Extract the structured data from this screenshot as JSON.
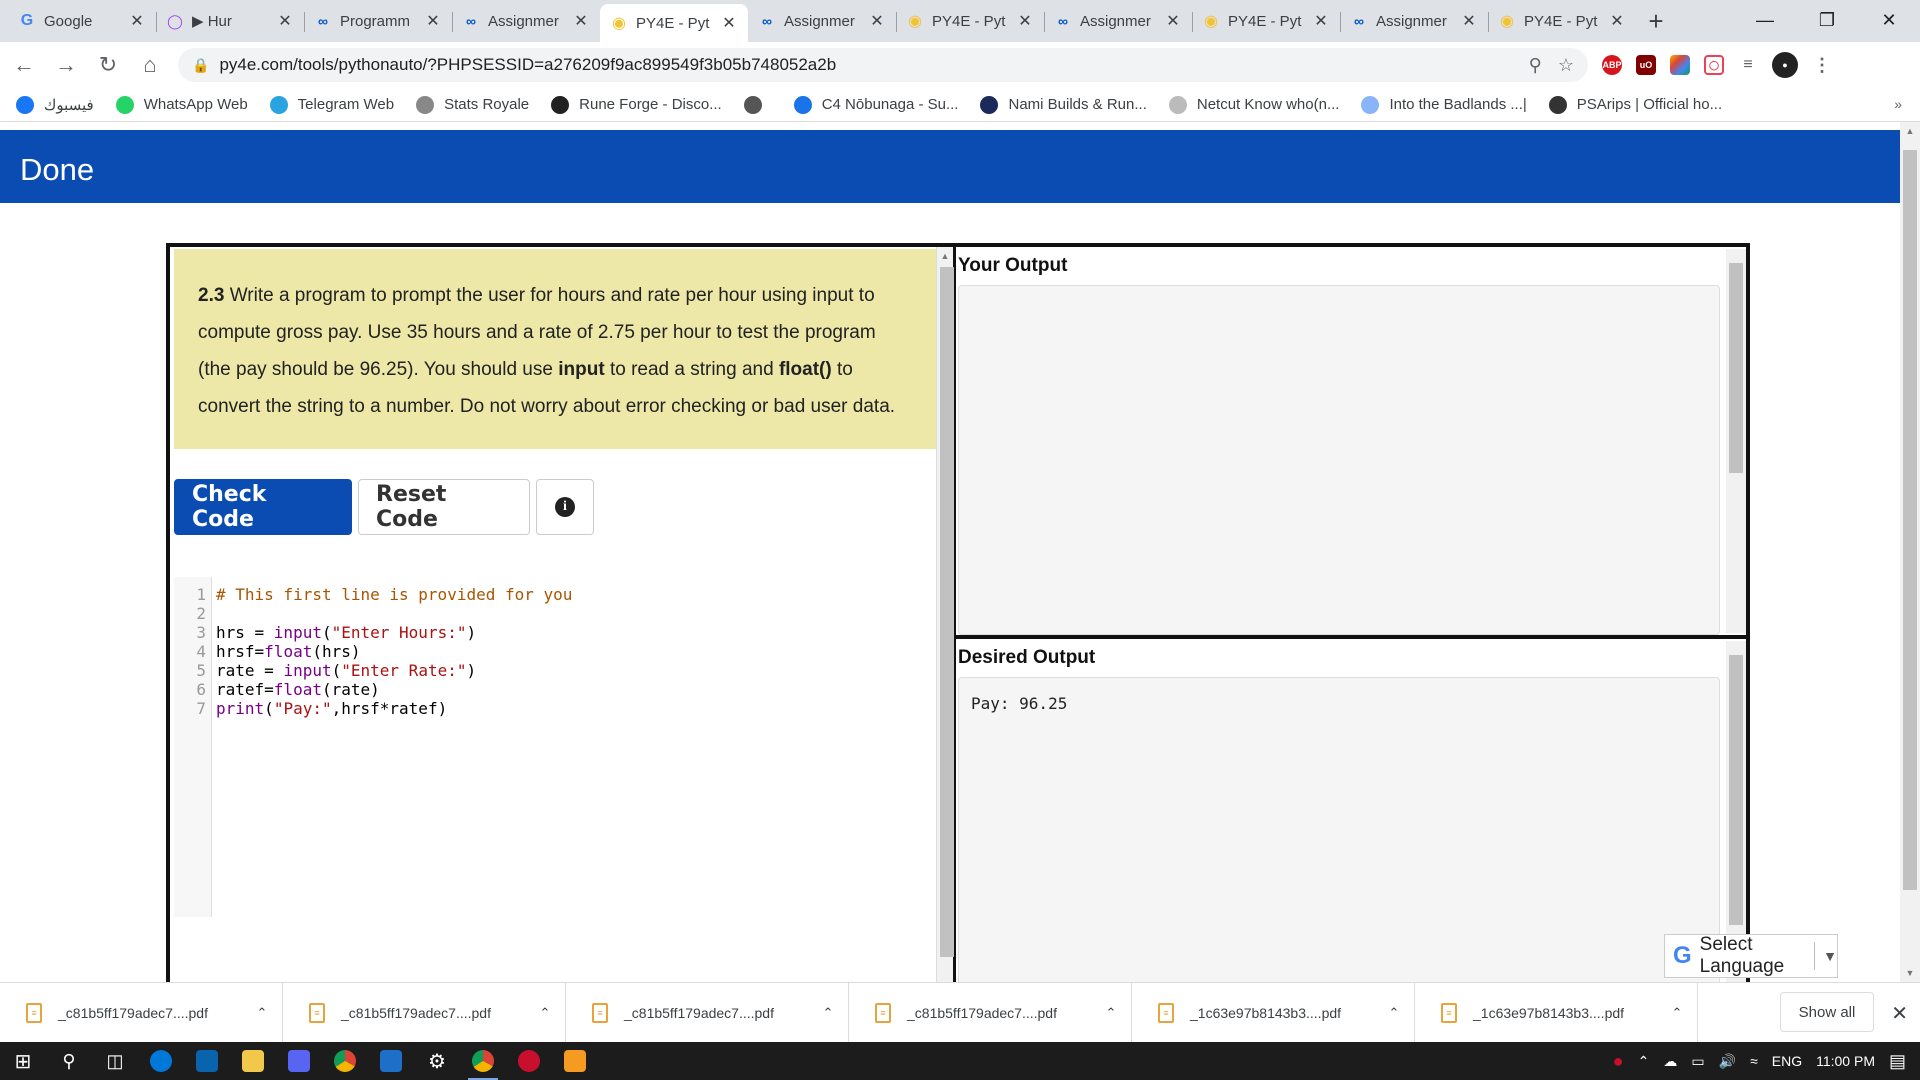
{
  "browser": {
    "tabs": [
      {
        "title": "Google",
        "icon": "google-icon",
        "active": false
      },
      {
        "title": "▶ Hur",
        "icon": "media-icon",
        "active": false
      },
      {
        "title": "Programm",
        "icon": "coursera-icon",
        "active": false
      },
      {
        "title": "Assignmer",
        "icon": "coursera-icon",
        "active": false
      },
      {
        "title": "PY4E - Pyt",
        "icon": "python-icon",
        "active": true
      },
      {
        "title": "Assignmer",
        "icon": "coursera-icon",
        "active": false
      },
      {
        "title": "PY4E - Pyt",
        "icon": "python-icon",
        "active": false
      },
      {
        "title": "Assignmer",
        "icon": "coursera-icon",
        "active": false
      },
      {
        "title": "PY4E - Pyt",
        "icon": "python-icon",
        "active": false
      },
      {
        "title": "Assignmer",
        "icon": "coursera-icon",
        "active": false
      },
      {
        "title": "PY4E - Pyt",
        "icon": "python-icon",
        "active": false
      }
    ],
    "url": "py4e.com/tools/pythonauto/?PHPSESSID=a276209f9ac899549f3b05b748052a2b",
    "bookmarks": [
      {
        "label": "فيسبوك",
        "icon": "facebook-icon",
        "color": "#1877f2"
      },
      {
        "label": "WhatsApp Web",
        "icon": "whatsapp-icon",
        "color": "#25d366"
      },
      {
        "label": "Telegram Web",
        "icon": "telegram-icon",
        "color": "#2aa3e0"
      },
      {
        "label": "Stats Royale",
        "icon": "stats-royale-icon",
        "color": "#888888"
      },
      {
        "label": "Rune Forge - Disco...",
        "icon": "rune-forge-icon",
        "color": "#222222"
      },
      {
        "label": "",
        "icon": "globe-icon",
        "color": "#555555"
      },
      {
        "label": "C4 Nōbunaga - Su...",
        "icon": "c4-icon",
        "color": "#1a73e8"
      },
      {
        "label": "Nami Builds & Run...",
        "icon": "nami-icon",
        "color": "#1a2a5a"
      },
      {
        "label": "Netcut Know who(n...",
        "icon": "netcut-icon",
        "color": "#bbbbbb"
      },
      {
        "label": "Into the Badlands ...|",
        "icon": "badlands-icon",
        "color": "#8ab4f8"
      },
      {
        "label": "PSArips | Official ho...",
        "icon": "psarips-icon",
        "color": "#333333"
      }
    ],
    "bookmarks_more": "»"
  },
  "page": {
    "banner_title": "Done",
    "prompt": {
      "number": "2.3",
      "text_1": " Write a program to prompt the user for hours and rate per hour using input to compute gross pay. Use 35 hours and a rate of 2.75 per hour to test the program (the pay should be 96.25). You should use ",
      "bold_1": "input",
      "text_2": " to read a string and ",
      "bold_2": "float()",
      "text_3": " to convert the string to a number. Do not worry about error checking or bad user data."
    },
    "buttons": {
      "check": "Check Code",
      "reset": "Reset Code"
    },
    "code_lines": [
      {
        "n": "1",
        "text": "# This first line is provided for you"
      },
      {
        "n": "2",
        "text": ""
      },
      {
        "n": "3",
        "text": "hrs = input(\"Enter Hours:\")"
      },
      {
        "n": "4",
        "text": "hrsf=float(hrs)"
      },
      {
        "n": "5",
        "text": "rate = input(\"Enter Rate:\")"
      },
      {
        "n": "6",
        "text": "ratef=float(rate)"
      },
      {
        "n": "7",
        "text": "print(\"Pay:\",hrsf*ratef)"
      }
    ],
    "your_output_title": "Your Output",
    "your_output_text": "",
    "desired_output_title": "Desired Output",
    "desired_output_text": "Pay: 96.25",
    "translate_label": "Select Language"
  },
  "downloads": {
    "items": [
      "_c81b5ff179adec7....pdf",
      "_c81b5ff179adec7....pdf",
      "_c81b5ff179adec7....pdf",
      "_c81b5ff179adec7....pdf",
      "_1c63e97b8143b3....pdf",
      "_1c63e97b8143b3....pdf"
    ],
    "show_all": "Show all"
  },
  "taskbar": {
    "language": "ENG",
    "time": "11:00 PM"
  },
  "colors": {
    "banner": "#0b4cb3",
    "prompt_bg": "#ede7a8",
    "primary_button": "#0b4cb3"
  }
}
